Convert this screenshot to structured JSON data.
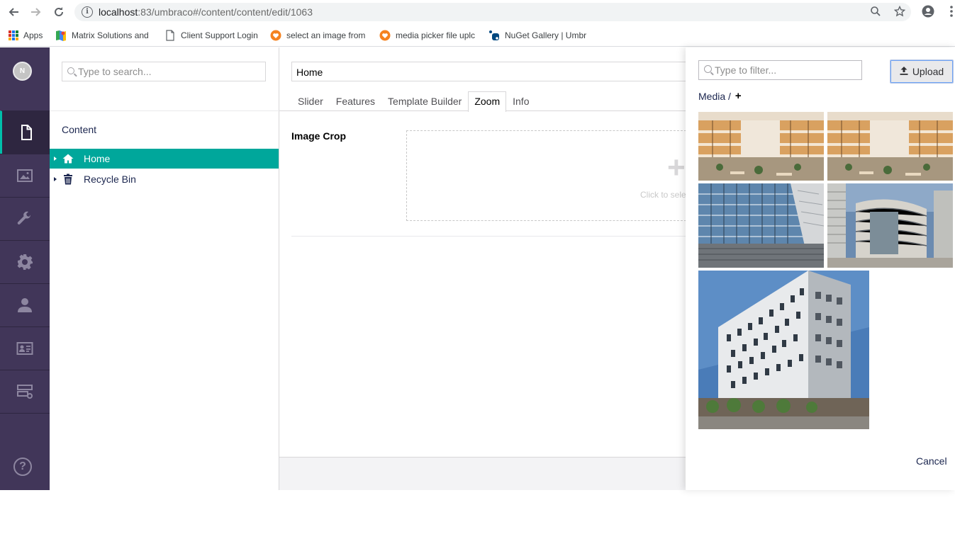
{
  "browser": {
    "url_host": "localhost",
    "url_rest": ":83/umbraco#/content/content/edit/1063",
    "bookmarks": [
      {
        "label": "Apps"
      },
      {
        "label": "Matrix Solutions and"
      },
      {
        "label": "Client Support Login"
      },
      {
        "label": "select an image from"
      },
      {
        "label": "media picker file uplc"
      },
      {
        "label": "NuGet Gallery | Umbr"
      }
    ]
  },
  "user": {
    "avatar_initial": "N"
  },
  "sections": [
    {
      "name": "content",
      "icon": "document-icon",
      "active": true
    },
    {
      "name": "media",
      "icon": "image-icon"
    },
    {
      "name": "settings",
      "icon": "wrench-icon"
    },
    {
      "name": "packages",
      "icon": "gear-icon"
    },
    {
      "name": "users",
      "icon": "user-icon"
    },
    {
      "name": "members",
      "icon": "id-card-icon"
    },
    {
      "name": "forms",
      "icon": "server-icon"
    }
  ],
  "tree": {
    "search_placeholder": "Type to search...",
    "header": "Content",
    "nodes": [
      {
        "label": "Home",
        "icon": "home-icon",
        "selected": true
      },
      {
        "label": "Recycle Bin",
        "icon": "trash-icon"
      }
    ]
  },
  "editor": {
    "name_value": "Home",
    "tabs": [
      "Slider",
      "Features",
      "Template Builder",
      "Zoom",
      "Info"
    ],
    "active_tab": "Zoom",
    "property_label": "Image Crop",
    "dropzone_hint": "Click to sele"
  },
  "media_picker": {
    "filter_placeholder": "Type to filter...",
    "upload_label": "Upload",
    "breadcrumb": "Media /",
    "breadcrumb_add": "+",
    "cancel_label": "Cancel"
  },
  "colors": {
    "sections_bg": "#413659",
    "selected_node": "#00a79b",
    "active_accent": "#00bfaa"
  }
}
